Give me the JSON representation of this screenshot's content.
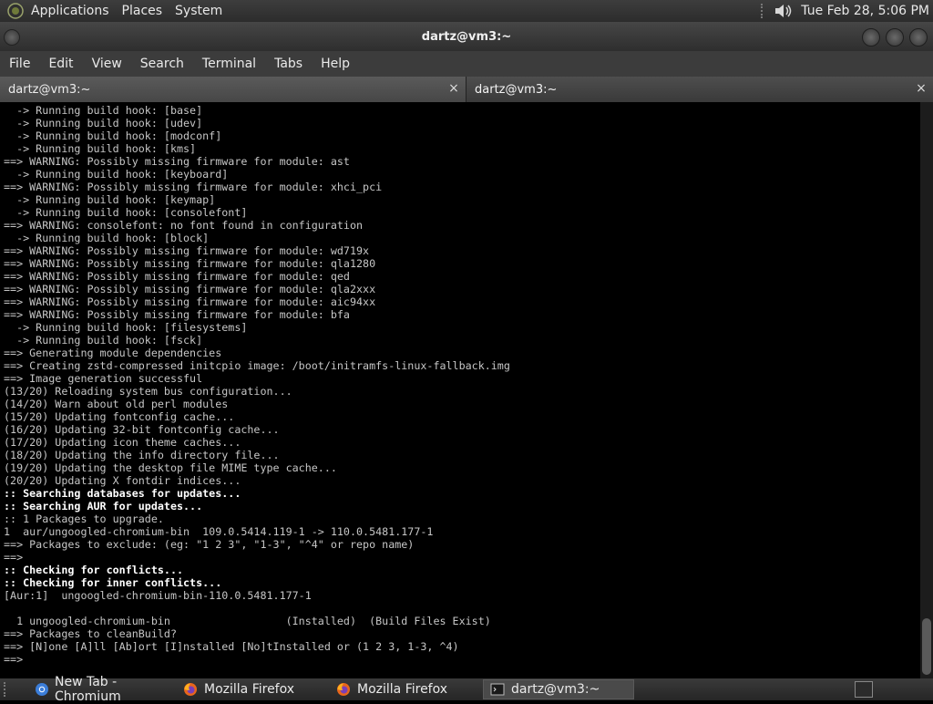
{
  "top_panel": {
    "menus": [
      "Applications",
      "Places",
      "System"
    ],
    "clock": "Tue Feb 28,  5:06 PM"
  },
  "window": {
    "title": "dartz@vm3:~"
  },
  "menubar": [
    "File",
    "Edit",
    "View",
    "Search",
    "Terminal",
    "Tabs",
    "Help"
  ],
  "tabs": [
    {
      "label": "dartz@vm3:~",
      "close": "×"
    },
    {
      "label": "dartz@vm3:~",
      "close": "×"
    }
  ],
  "terminal": {
    "lines": [
      {
        "text": "  -> Running build hook: [base]"
      },
      {
        "text": "  -> Running build hook: [udev]"
      },
      {
        "text": "  -> Running build hook: [modconf]"
      },
      {
        "text": "  -> Running build hook: [kms]"
      },
      {
        "text": "==> WARNING: Possibly missing firmware for module: ast"
      },
      {
        "text": "  -> Running build hook: [keyboard]"
      },
      {
        "text": "==> WARNING: Possibly missing firmware for module: xhci_pci"
      },
      {
        "text": "  -> Running build hook: [keymap]"
      },
      {
        "text": "  -> Running build hook: [consolefont]"
      },
      {
        "text": "==> WARNING: consolefont: no font found in configuration"
      },
      {
        "text": "  -> Running build hook: [block]"
      },
      {
        "text": "==> WARNING: Possibly missing firmware for module: wd719x"
      },
      {
        "text": "==> WARNING: Possibly missing firmware for module: qla1280"
      },
      {
        "text": "==> WARNING: Possibly missing firmware for module: qed"
      },
      {
        "text": "==> WARNING: Possibly missing firmware for module: qla2xxx"
      },
      {
        "text": "==> WARNING: Possibly missing firmware for module: aic94xx"
      },
      {
        "text": "==> WARNING: Possibly missing firmware for module: bfa"
      },
      {
        "text": "  -> Running build hook: [filesystems]"
      },
      {
        "text": "  -> Running build hook: [fsck]"
      },
      {
        "text": "==> Generating module dependencies"
      },
      {
        "text": "==> Creating zstd-compressed initcpio image: /boot/initramfs-linux-fallback.img"
      },
      {
        "text": "==> Image generation successful"
      },
      {
        "text": "(13/20) Reloading system bus configuration..."
      },
      {
        "text": "(14/20) Warn about old perl modules"
      },
      {
        "text": "(15/20) Updating fontconfig cache..."
      },
      {
        "text": "(16/20) Updating 32-bit fontconfig cache..."
      },
      {
        "text": "(17/20) Updating icon theme caches..."
      },
      {
        "text": "(18/20) Updating the info directory file..."
      },
      {
        "text": "(19/20) Updating the desktop file MIME type cache..."
      },
      {
        "text": "(20/20) Updating X fontdir indices..."
      },
      {
        "text": ":: Searching databases for updates...",
        "bold": true
      },
      {
        "text": ":: Searching AUR for updates...",
        "bold": true
      },
      {
        "text": ":: 1 Packages to upgrade."
      },
      {
        "text": "1  aur/ungoogled-chromium-bin  109.0.5414.119-1 -> 110.0.5481.177-1"
      },
      {
        "text": "==> Packages to exclude: (eg: \"1 2 3\", \"1-3\", \"^4\" or repo name)"
      },
      {
        "text": "==>"
      },
      {
        "text": ":: Checking for conflicts...",
        "bold": true
      },
      {
        "text": ":: Checking for inner conflicts...",
        "bold": true
      },
      {
        "text": "[Aur:1]  ungoogled-chromium-bin-110.0.5481.177-1"
      },
      {
        "text": ""
      },
      {
        "text": "  1 ungoogled-chromium-bin                  (Installed)  (Build Files Exist)"
      },
      {
        "text": "==> Packages to cleanBuild?"
      },
      {
        "text": "==> [N]one [A]ll [Ab]ort [I]nstalled [No]tInstalled or (1 2 3, 1-3, ^4)"
      },
      {
        "text": "==>"
      }
    ]
  },
  "taskbar": {
    "tasks": [
      {
        "label": "New Tab - Chromium",
        "icon": "chromium-icon",
        "active": false
      },
      {
        "label": "Mozilla Firefox",
        "icon": "firefox-icon",
        "active": false
      },
      {
        "label": "Mozilla Firefox",
        "icon": "firefox-icon",
        "active": false
      },
      {
        "label": "dartz@vm3:~",
        "icon": "terminal-icon",
        "active": true
      }
    ]
  }
}
